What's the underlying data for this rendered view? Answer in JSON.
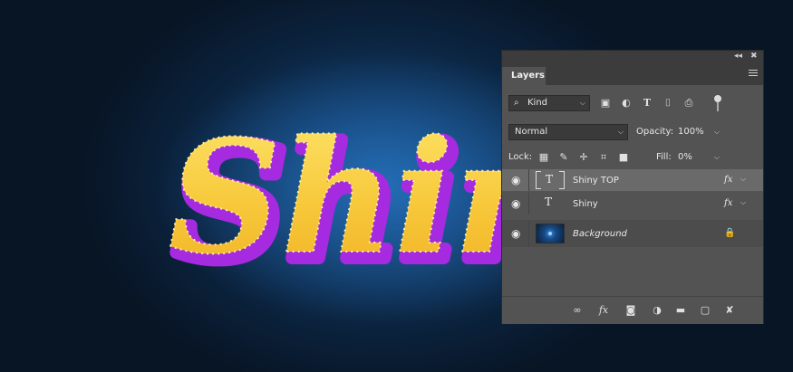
{
  "artwork": {
    "text": "Shiny",
    "colors": {
      "fill": "#f7c83a",
      "fill_highlight": "#fde56a",
      "outline": "#a62ae0",
      "background_center": "#1c5a95",
      "background_edge": "#081525"
    }
  },
  "panel": {
    "collapse_icon": "double-chevron-icon",
    "close_icon": "close-icon",
    "tab_label": "Layers",
    "menu_icon": "panel-menu-icon",
    "filter": {
      "kind_label": "Kind",
      "icons": [
        "image-filter-icon",
        "adjustment-filter-icon",
        "type-filter-icon",
        "shape-filter-icon",
        "smart-object-filter-icon"
      ]
    },
    "blend": {
      "mode": "Normal",
      "opacity_label": "Opacity:",
      "opacity_value": "100%"
    },
    "lock": {
      "label": "Lock:",
      "fill_label": "Fill:",
      "fill_value": "0%",
      "icons": [
        "lock-transparent-icon",
        "lock-paint-icon",
        "lock-move-icon",
        "lock-artboard-icon",
        "lock-all-icon"
      ]
    },
    "layers": [
      {
        "name": "Shiny TOP",
        "kind": "text",
        "fx": "fx",
        "selected": true
      },
      {
        "name": "Shiny",
        "kind": "text",
        "fx": "fx",
        "selected": false
      },
      {
        "name": "Background",
        "kind": "image",
        "locked": true,
        "selected": false
      }
    ],
    "bottom_icons": [
      "link-icon",
      "fx-icon",
      "mask-icon",
      "adjustment-icon",
      "folder-icon",
      "new-layer-icon",
      "trash-icon"
    ]
  }
}
